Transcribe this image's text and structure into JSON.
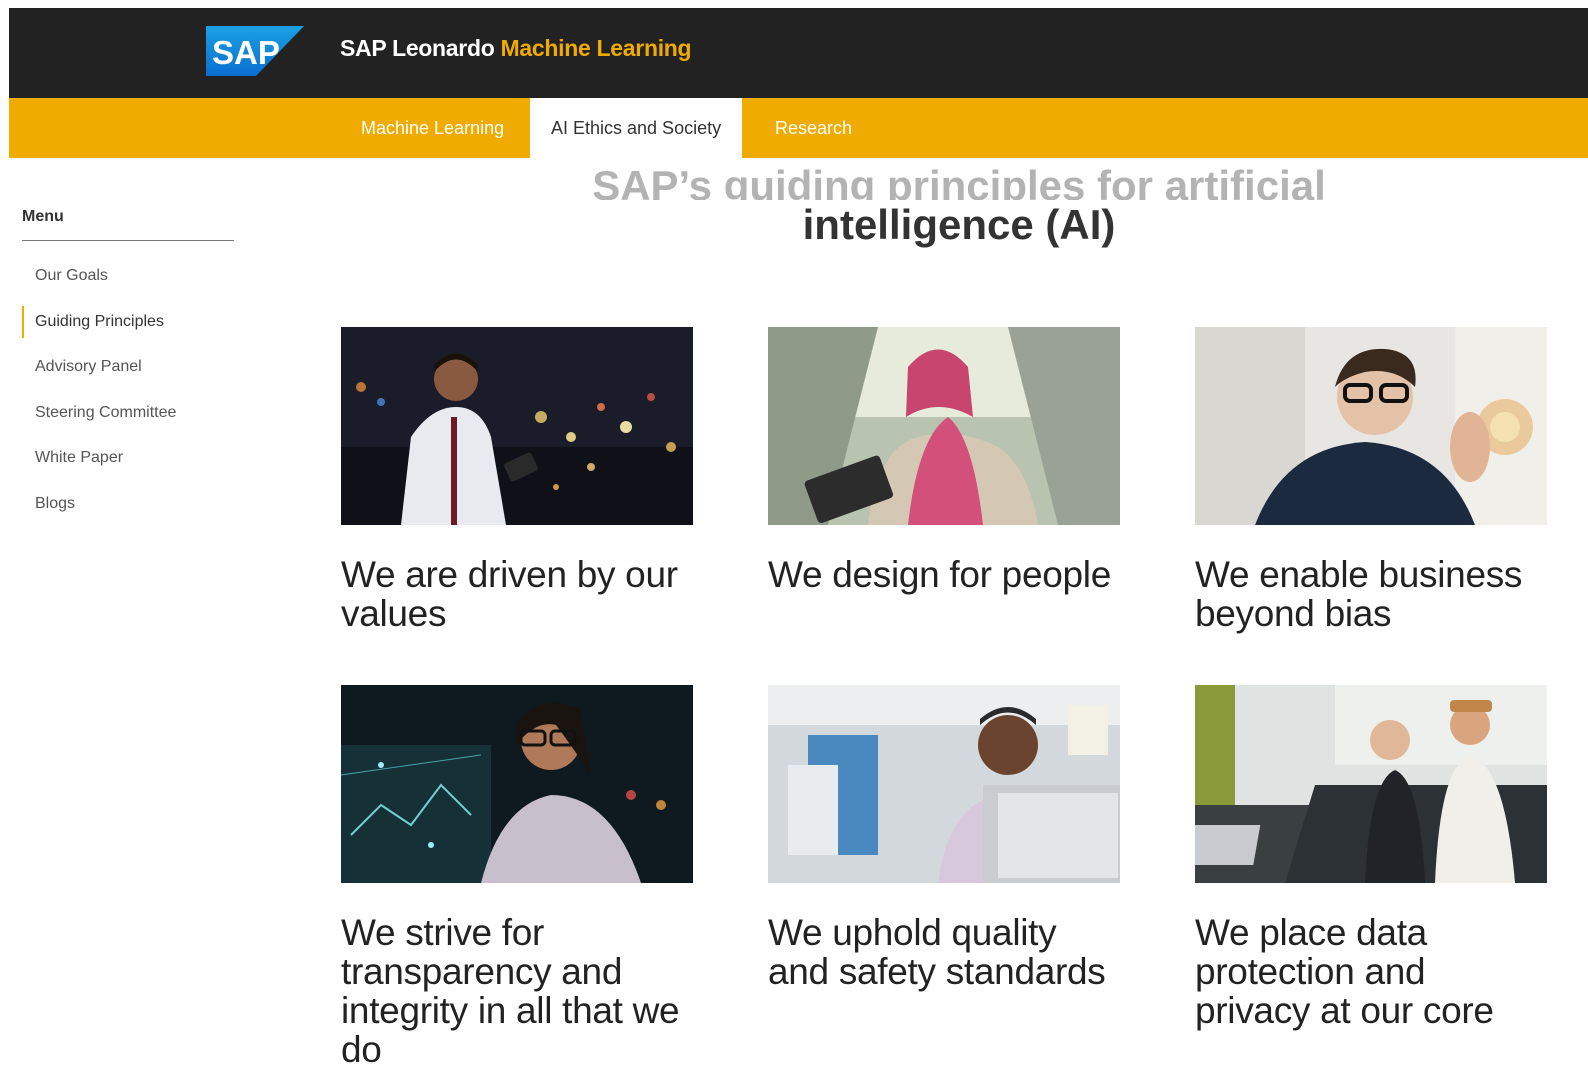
{
  "header": {
    "logo_text": "SAP",
    "brand_prefix": "SAP Leonardo",
    "brand_accent": "Machine Learning",
    "accent_color": "#f0ab00",
    "bar_color": "#222222"
  },
  "nav": {
    "tabs": [
      {
        "label": "Machine Learning",
        "active": false
      },
      {
        "label": "AI Ethics and Society",
        "active": true
      },
      {
        "label": "Research",
        "active": false
      }
    ]
  },
  "sidebar": {
    "title": "Menu",
    "items": [
      {
        "label": "Our Goals",
        "active": false
      },
      {
        "label": "Guiding Principles",
        "active": true
      },
      {
        "label": "Advisory Panel",
        "active": false
      },
      {
        "label": "Steering Committee",
        "active": false
      },
      {
        "label": "White Paper",
        "active": false
      },
      {
        "label": "Blogs",
        "active": false
      }
    ]
  },
  "main": {
    "heading_line1": "SAP’s guiding principles for artificial",
    "heading_line2": "intelligence (AI)",
    "cards": [
      {
        "title": "We are driven by our values",
        "image": "man-with-tablet-city-night-photo"
      },
      {
        "title": "We design for people",
        "image": "woman-in-car-with-tablet-photo"
      },
      {
        "title": "We enable business beyond bias",
        "image": "young-man-with-glasses-photo"
      },
      {
        "title": "We strive for transparency and integrity in all that we do",
        "image": "woman-with-holographic-data-photo"
      },
      {
        "title": "We uphold quality and safety standards",
        "image": "man-at-laptop-office-photo"
      },
      {
        "title": "We place data protection and privacy at our core",
        "image": "two-people-on-sofa-photo"
      }
    ]
  }
}
